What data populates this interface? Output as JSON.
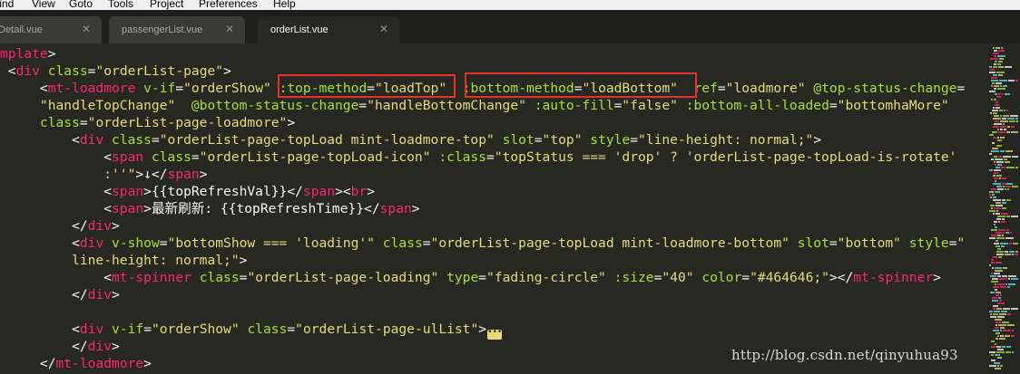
{
  "menu": {
    "items": [
      "Find",
      "View",
      "Goto",
      "Tools",
      "Project",
      "Preferences",
      "Help"
    ]
  },
  "tabs": [
    {
      "label": "Detail.vue",
      "active": false
    },
    {
      "label": "passengerList.vue",
      "active": false
    },
    {
      "label": "orderList.vue",
      "active": true
    }
  ],
  "tab_close_glyph": "✕",
  "code_lines": [
    [
      [
        "tg",
        "mplate"
      ],
      [
        "tx",
        ">"
      ]
    ],
    [
      [
        "tx",
        " <"
      ],
      [
        "tg",
        "div"
      ],
      [
        "tx",
        " "
      ],
      [
        "at",
        "class"
      ],
      [
        "tx",
        "="
      ],
      [
        "st",
        "\"orderList-page\""
      ],
      [
        "tx",
        ">"
      ]
    ],
    [
      [
        "tx",
        "     <"
      ],
      [
        "tg",
        "mt-loadmore"
      ],
      [
        "tx",
        " "
      ],
      [
        "at",
        "v-if"
      ],
      [
        "tx",
        "="
      ],
      [
        "st",
        "\"orderShow\""
      ],
      [
        "tx",
        " "
      ],
      [
        "at",
        ":top-method"
      ],
      [
        "tx",
        "="
      ],
      [
        "st",
        "\"loadTop\""
      ],
      [
        "tx",
        "  "
      ],
      [
        "at",
        ":bottom-method"
      ],
      [
        "tx",
        "="
      ],
      [
        "st",
        "\"loadBottom\""
      ],
      [
        "tx",
        "  "
      ],
      [
        "at",
        "ref"
      ],
      [
        "tx",
        "="
      ],
      [
        "st",
        "\"loadmore\""
      ],
      [
        "tx",
        " "
      ],
      [
        "at",
        "@top-status-change"
      ],
      [
        "tx",
        "="
      ]
    ],
    [
      [
        "st",
        "     \"handleTopChange\""
      ],
      [
        "tx",
        "  "
      ],
      [
        "at",
        "@bottom-status-change"
      ],
      [
        "tx",
        "="
      ],
      [
        "st",
        "\"handleBottomChange\""
      ],
      [
        "tx",
        " "
      ],
      [
        "at",
        ":auto-fill"
      ],
      [
        "tx",
        "="
      ],
      [
        "st",
        "\"false\""
      ],
      [
        "tx",
        " "
      ],
      [
        "at",
        ":bottom-all-loaded"
      ],
      [
        "tx",
        "="
      ],
      [
        "st",
        "\"bottomhaMore\""
      ]
    ],
    [
      [
        "at",
        "     class"
      ],
      [
        "tx",
        "="
      ],
      [
        "st",
        "\"orderList-page-loadmore\""
      ],
      [
        "tx",
        ">"
      ]
    ],
    [
      [
        "tx",
        "         <"
      ],
      [
        "tg",
        "div"
      ],
      [
        "tx",
        " "
      ],
      [
        "at",
        "class"
      ],
      [
        "tx",
        "="
      ],
      [
        "st",
        "\"orderList-page-topLoad mint-loadmore-top\""
      ],
      [
        "tx",
        " "
      ],
      [
        "at",
        "slot"
      ],
      [
        "tx",
        "="
      ],
      [
        "st",
        "\"top\""
      ],
      [
        "tx",
        " "
      ],
      [
        "at",
        "style"
      ],
      [
        "tx",
        "="
      ],
      [
        "st",
        "\"line-height: normal;\""
      ],
      [
        "tx",
        ">"
      ]
    ],
    [
      [
        "tx",
        "             <"
      ],
      [
        "tg",
        "span"
      ],
      [
        "tx",
        " "
      ],
      [
        "at",
        "class"
      ],
      [
        "tx",
        "="
      ],
      [
        "st",
        "\"orderList-page-topLoad-icon\""
      ],
      [
        "tx",
        " "
      ],
      [
        "at",
        ":class"
      ],
      [
        "tx",
        "="
      ],
      [
        "st",
        "\"topStatus === 'drop' ? 'orderList-page-topLoad-is-rotate'"
      ]
    ],
    [
      [
        "st",
        "             :''\""
      ],
      [
        "tx",
        ">↓</"
      ],
      [
        "tg",
        "span"
      ],
      [
        "tx",
        ">"
      ]
    ],
    [
      [
        "tx",
        "             <"
      ],
      [
        "tg",
        "span"
      ],
      [
        "tx",
        ">{{topRefreshVal}}</"
      ],
      [
        "tg",
        "span"
      ],
      [
        "tx",
        "><"
      ],
      [
        "tg",
        "br"
      ],
      [
        "tx",
        ">"
      ]
    ],
    [
      [
        "tx",
        "             <"
      ],
      [
        "tg",
        "span"
      ],
      [
        "tx",
        ">最新刷新: {{topRefreshTime}}</"
      ],
      [
        "tg",
        "span"
      ],
      [
        "tx",
        ">"
      ]
    ],
    [
      [
        "tx",
        "         </"
      ],
      [
        "tg",
        "div"
      ],
      [
        "tx",
        ">"
      ]
    ],
    [
      [
        "tx",
        "         <"
      ],
      [
        "tg",
        "div"
      ],
      [
        "tx",
        " "
      ],
      [
        "at",
        "v-show"
      ],
      [
        "tx",
        "="
      ],
      [
        "st",
        "\"bottomShow === 'loading'\""
      ],
      [
        "tx",
        " "
      ],
      [
        "at",
        "class"
      ],
      [
        "tx",
        "="
      ],
      [
        "st",
        "\"orderList-page-topLoad mint-loadmore-bottom\""
      ],
      [
        "tx",
        " "
      ],
      [
        "at",
        "slot"
      ],
      [
        "tx",
        "="
      ],
      [
        "st",
        "\"bottom\""
      ],
      [
        "tx",
        " "
      ],
      [
        "at",
        "style"
      ],
      [
        "tx",
        "="
      ],
      [
        "st",
        "\""
      ]
    ],
    [
      [
        "st",
        "         line-height: normal;\""
      ],
      [
        "tx",
        ">"
      ]
    ],
    [
      [
        "tx",
        "             <"
      ],
      [
        "tg",
        "mt-spinner"
      ],
      [
        "tx",
        " "
      ],
      [
        "at",
        "class"
      ],
      [
        "tx",
        "="
      ],
      [
        "st",
        "\"orderList-page-loading\""
      ],
      [
        "tx",
        " "
      ],
      [
        "at",
        "type"
      ],
      [
        "tx",
        "="
      ],
      [
        "st",
        "\"fading-circle\""
      ],
      [
        "tx",
        " "
      ],
      [
        "at",
        ":size"
      ],
      [
        "tx",
        "="
      ],
      [
        "st",
        "\"40\""
      ],
      [
        "tx",
        " "
      ],
      [
        "at",
        "color"
      ],
      [
        "tx",
        "="
      ],
      [
        "st",
        "\"#464646;\""
      ],
      [
        "tx",
        "></"
      ],
      [
        "tg",
        "mt-spinner"
      ],
      [
        "tx",
        ">"
      ]
    ],
    [
      [
        "tx",
        "         </"
      ],
      [
        "tg",
        "div"
      ],
      [
        "tx",
        ">"
      ]
    ],
    [
      [
        "tx",
        ""
      ]
    ],
    [
      [
        "tx",
        "         <"
      ],
      [
        "tg",
        "div"
      ],
      [
        "tx",
        " "
      ],
      [
        "at",
        "v-if"
      ],
      [
        "tx",
        "="
      ],
      [
        "st",
        "\"orderShow\""
      ],
      [
        "tx",
        " "
      ],
      [
        "at",
        "class"
      ],
      [
        "tx",
        "="
      ],
      [
        "st",
        "\"orderList-page-ulList\""
      ],
      [
        "tx",
        ">"
      ],
      [
        "fold",
        "•••"
      ]
    ],
    [
      [
        "tx",
        "         </"
      ],
      [
        "tg",
        "div"
      ],
      [
        "tx",
        ">"
      ]
    ],
    [
      [
        "tx",
        "     </"
      ],
      [
        "tg",
        "mt-loadmore"
      ],
      [
        "tx",
        ">"
      ]
    ]
  ],
  "watermark": "http://blog.csdn.net/qinyuhua93",
  "colors": {
    "background": "#272822",
    "tag": "#f92672",
    "attribute": "#a6e22e",
    "string": "#e6db74",
    "text": "#f8f8f2",
    "highlight_box": "#e8302b"
  }
}
